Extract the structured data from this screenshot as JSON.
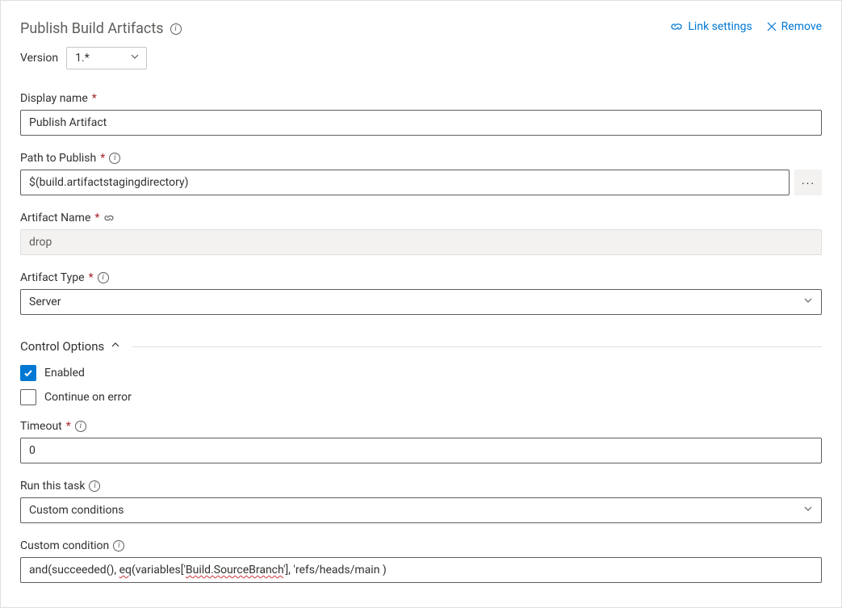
{
  "header": {
    "title": "Publish Build Artifacts",
    "actions": {
      "link_settings": "Link settings",
      "remove": "Remove"
    }
  },
  "version": {
    "label": "Version",
    "value": "1.*"
  },
  "fields": {
    "display_name": {
      "label": "Display name",
      "value": "Publish Artifact"
    },
    "path_to_publish": {
      "label": "Path to Publish",
      "value": "$(build.artifactstagingdirectory)"
    },
    "artifact_name": {
      "label": "Artifact Name",
      "value": "drop"
    },
    "artifact_type": {
      "label": "Artifact Type",
      "value": "Server"
    }
  },
  "control_options": {
    "title": "Control Options",
    "enabled_label": "Enabled",
    "continue_on_error_label": "Continue on error",
    "timeout": {
      "label": "Timeout",
      "value": "0"
    },
    "run_this_task": {
      "label": "Run this task",
      "value": "Custom conditions"
    },
    "custom_condition": {
      "label": "Custom condition",
      "prefix": "and(succeeded(), ",
      "squiggle1": "eq",
      "mid": "(variables['",
      "squiggle2": "Build.SourceBranch",
      "suffix": "'], 'refs/heads/main )"
    }
  },
  "required_mark": "*"
}
